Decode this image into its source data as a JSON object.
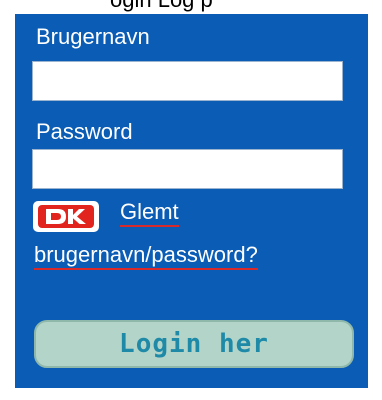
{
  "header": {
    "clipped_text": "ogin Log p"
  },
  "login_form": {
    "username_label": "Brugernavn",
    "username_value": "",
    "password_label": "Password",
    "password_value": "",
    "forgot_link_line1": "Glemt",
    "forgot_link_line2": "brugernavn/password?",
    "logo_text": "DK",
    "login_button_label": "Login her"
  },
  "colors": {
    "panel_background": "#0a5cb4",
    "button_background": "#b2d4c9",
    "button_text": "#1e8aa8",
    "link_underline": "#d82a2a",
    "logo_red": "#e2241e"
  }
}
